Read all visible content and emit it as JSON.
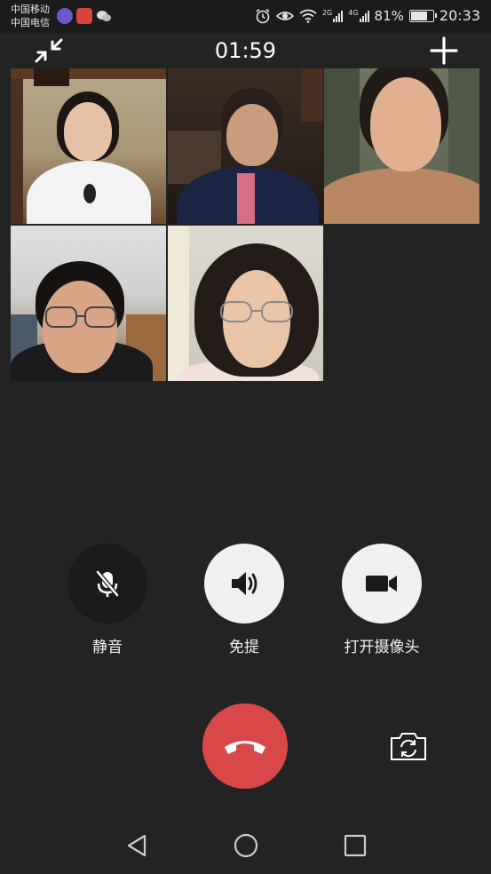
{
  "status_bar": {
    "carrier_1": "中国移动",
    "carrier_2": "中国电信",
    "network_1": "2G",
    "network_2": "4G",
    "battery": "81%",
    "battery_level": 0.81,
    "time": "20:33",
    "app_icons": [
      "assistant-icon",
      "app-c-icon",
      "wechat-icon"
    ],
    "system_icons": [
      "alarm-icon",
      "eye-icon",
      "wifi-icon",
      "signal-icon",
      "signal-icon",
      "battery-icon"
    ]
  },
  "call": {
    "duration": "01:59",
    "participants_count": 5
  },
  "controls": {
    "mute_label": "静音",
    "speaker_label": "免提",
    "camera_label": "打开摄像头",
    "hangup_icon": "phone-hangup-icon",
    "flip_icon": "camera-switch-icon"
  },
  "colors": {
    "background": "#232323",
    "hangup": "#d94848",
    "active_button": "#f0f0f0",
    "inactive_button": "#1a1a1a"
  }
}
